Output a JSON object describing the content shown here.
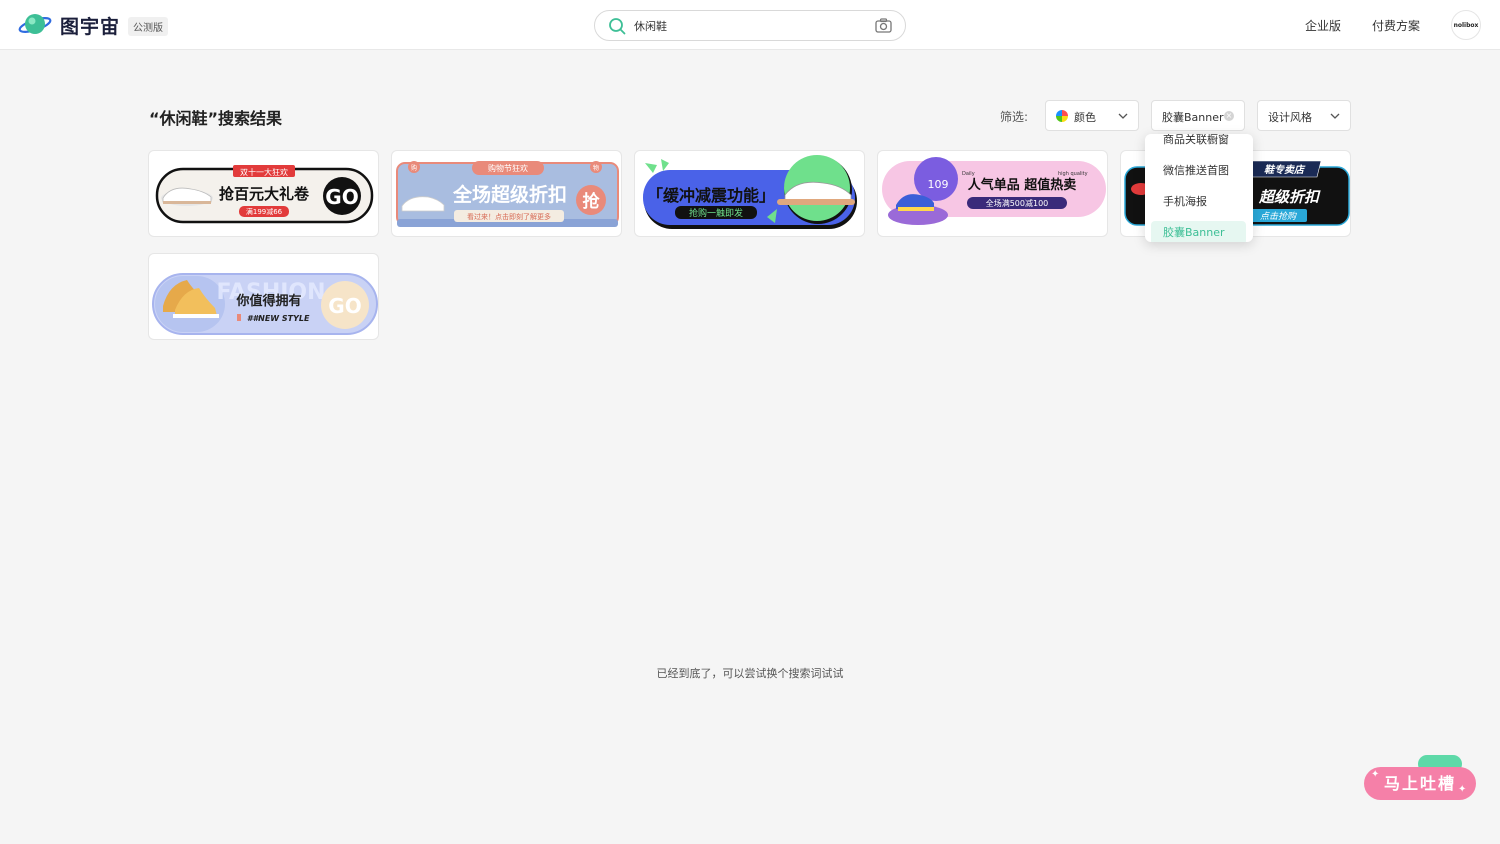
{
  "header": {
    "brand": "图宇宙",
    "beta": "公测版",
    "search_value": "休闲鞋",
    "nav": [
      "企业版",
      "付费方案"
    ],
    "avatar_text": "nolibox"
  },
  "results": {
    "title": "“休闲鞋”搜索结果",
    "filter_label": "筛选:",
    "filters": {
      "color": "颜色",
      "type": "胶囊Banner",
      "style": "设计风格"
    },
    "dropdown": [
      "商品关联橱窗",
      "微信推送首图",
      "手机海报",
      "胶囊Banner"
    ],
    "end_message": "已经到底了，可以尝试换个搜索词试试"
  },
  "cards": [
    {
      "tag": "双十一大狂欢",
      "title": "抢百元大礼卷",
      "sub": "满199减66",
      "btn": "GO"
    },
    {
      "tag": "购物节狂欢",
      "title": "全场超级折扣",
      "sub": "看过来！点击即刻了解更多",
      "btn": "抢",
      "corner_left": "购",
      "corner_right": "物"
    },
    {
      "title": "「缓冲减震功能」",
      "sub": "抢购一触即发"
    },
    {
      "title": "人气单品  超值热卖",
      "sub": "全场满500减100",
      "num": "109",
      "tiny_left": "Daily",
      "tiny_right": "high quality"
    },
    {
      "title": "鞋专卖店",
      "sub": "超级折扣",
      "sub2": "点击抢购"
    },
    {
      "title": "你值得拥有",
      "sub": "##NEW STYLE",
      "btn": "GO",
      "bg_word": "FASHION"
    }
  ],
  "feedback": {
    "label": "马上吐槽"
  },
  "colors": {
    "accent": "#3dbf96",
    "feedback": "#f580a8"
  },
  "icons": [
    "planet-logo-icon",
    "search-icon",
    "camera-icon",
    "chevron-down-icon",
    "clear-icon",
    "color-wheel-icon"
  ]
}
